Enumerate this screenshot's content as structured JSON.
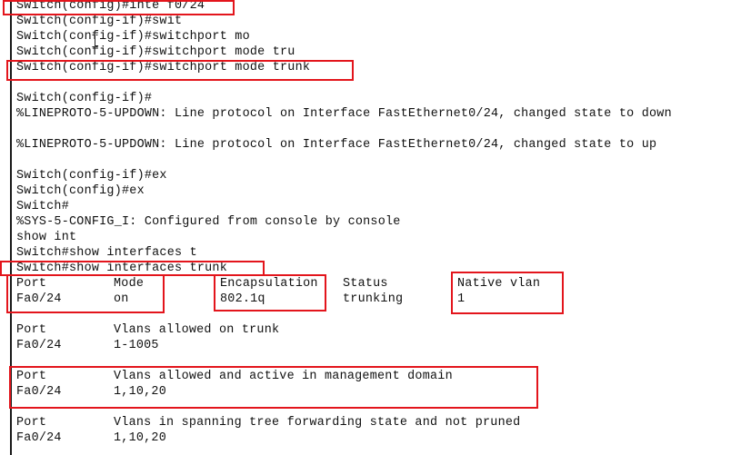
{
  "terminal": {
    "lines": [
      "Switch(config)#inte f0/24",
      "Switch(config-if)#swit",
      "Switch(config-if)#switchport mo",
      "Switch(config-if)#switchport mode tru",
      "Switch(config-if)#switchport mode trunk",
      "",
      "Switch(config-if)#",
      "%LINEPROTO-5-UPDOWN: Line protocol on Interface FastEthernet0/24, changed state to down",
      "",
      "%LINEPROTO-5-UPDOWN: Line protocol on Interface FastEthernet0/24, changed state to up",
      "",
      "Switch(config-if)#ex",
      "Switch(config)#ex",
      "Switch#",
      "%SYS-5-CONFIG_I: Configured from console by console",
      "show int",
      "Switch#show interfaces t",
      "Switch#show interfaces trunk"
    ],
    "table1": {
      "headers": [
        "Port",
        "Mode",
        "Encapsulation",
        "Status",
        "Native vlan"
      ],
      "row": [
        "Fa0/24",
        "on",
        "802.1q",
        "trunking",
        "1"
      ]
    },
    "table2": {
      "headers": [
        "Port",
        "Vlans allowed on trunk"
      ],
      "row": [
        "Fa0/24",
        "1-1005"
      ]
    },
    "table3": {
      "headers": [
        "Port",
        "Vlans allowed and active in management domain"
      ],
      "row": [
        "Fa0/24",
        "1,10,20"
      ]
    },
    "table4": {
      "headers": [
        "Port",
        "Vlans in spanning tree forwarding state and not pruned"
      ],
      "row": [
        "Fa0/24",
        "1,10,20"
      ]
    }
  },
  "colors": {
    "highlight_box": "#e3151c",
    "text": "#111111",
    "background": "#ffffff"
  }
}
